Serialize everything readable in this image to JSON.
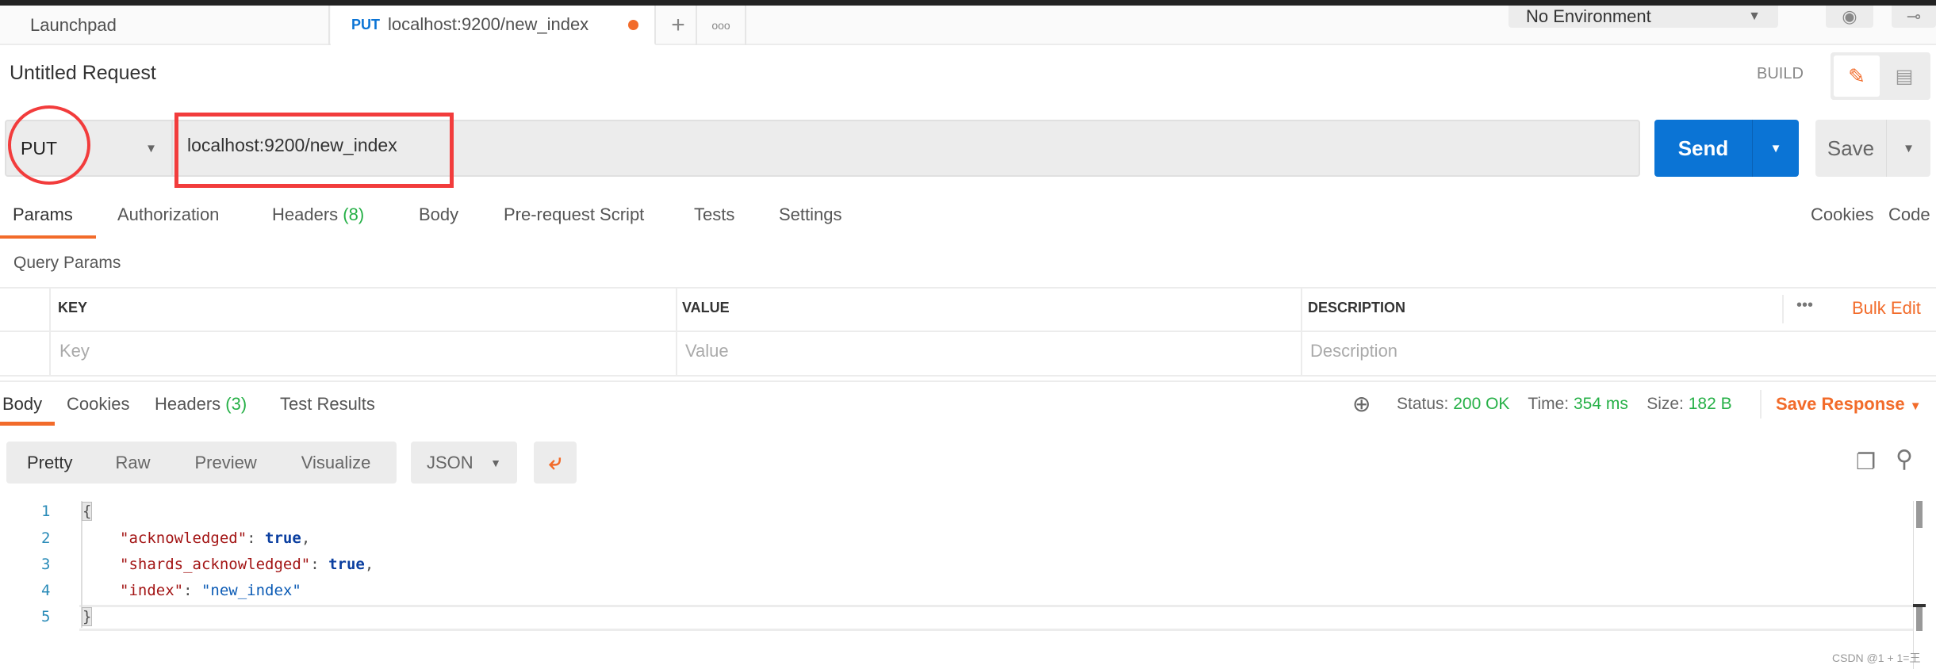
{
  "tabs": [
    {
      "label": "Launchpad"
    },
    {
      "method": "PUT",
      "label": "localhost:9200/new_index",
      "unsaved": true
    }
  ],
  "environment": {
    "selected": "No Environment"
  },
  "request": {
    "title": "Untitled Request",
    "mode": "BUILD",
    "method": "PUT",
    "url": "localhost:9200/new_index",
    "send": "Send",
    "save": "Save"
  },
  "request_tabs": [
    {
      "label": "Params",
      "active": true
    },
    {
      "label": "Authorization"
    },
    {
      "label": "Headers",
      "count": "(8)"
    },
    {
      "label": "Body"
    },
    {
      "label": "Pre-request Script"
    },
    {
      "label": "Tests"
    },
    {
      "label": "Settings"
    }
  ],
  "links": {
    "cookies": "Cookies",
    "code": "Code"
  },
  "query_params": {
    "title": "Query Params",
    "columns": [
      "KEY",
      "VALUE",
      "DESCRIPTION"
    ],
    "placeholders": [
      "Key",
      "Value",
      "Description"
    ],
    "bulk_edit": "Bulk Edit"
  },
  "response_tabs": [
    {
      "label": "Body",
      "active": true
    },
    {
      "label": "Cookies"
    },
    {
      "label": "Headers",
      "count": "(3)"
    },
    {
      "label": "Test Results"
    }
  ],
  "response_meta": {
    "status_label": "Status:",
    "status": "200 OK",
    "time_label": "Time:",
    "time": "354 ms",
    "size_label": "Size:",
    "size": "182 B",
    "save_response": "Save Response"
  },
  "format": {
    "modes": [
      "Pretty",
      "Raw",
      "Preview",
      "Visualize"
    ],
    "active": "Pretty",
    "language": "JSON"
  },
  "code_lines": [
    {
      "n": "1",
      "text": "{"
    },
    {
      "n": "2",
      "key": "\"acknowledged\"",
      "value": "true",
      "comma": ","
    },
    {
      "n": "3",
      "key": "\"shards_acknowledged\"",
      "value": "true",
      "comma": ","
    },
    {
      "n": "4",
      "key": "\"index\"",
      "str": "\"new_index\""
    },
    {
      "n": "5",
      "text": "}"
    }
  ],
  "watermark": "CSDN @1 + 1=王",
  "colors": {
    "accent": "#f26b2a",
    "send": "#0b74d5",
    "success": "#26b047",
    "annotation": "#f23c3c"
  }
}
